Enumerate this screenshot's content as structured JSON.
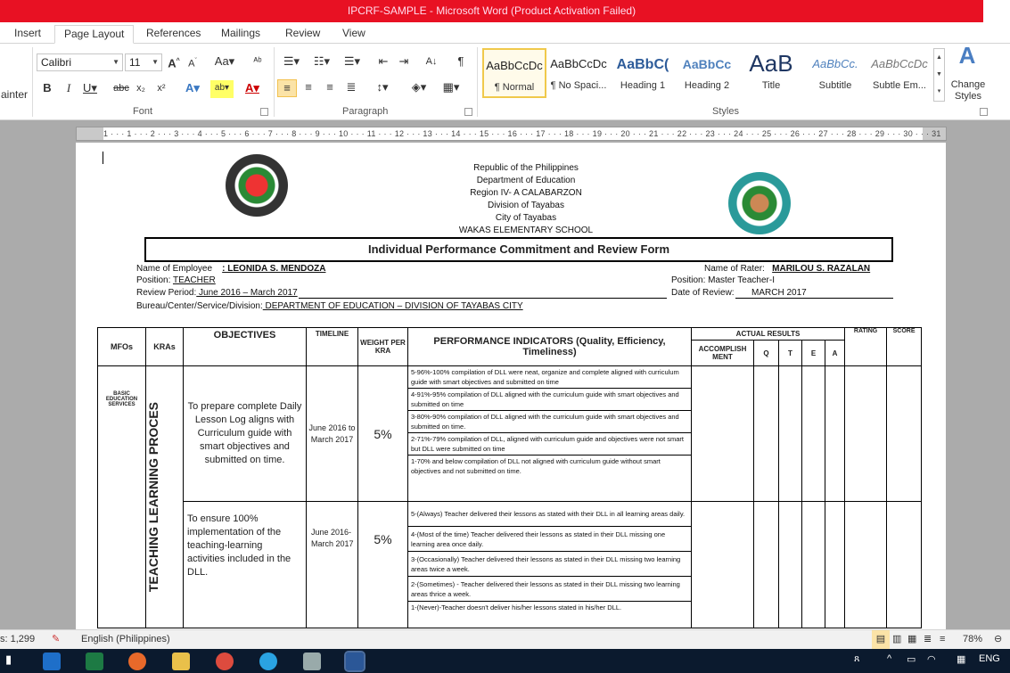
{
  "window": {
    "title": "IPCRF-SAMPLE  -  Microsoft Word (Product Activation Failed)"
  },
  "tabs": [
    "Insert",
    "Page Layout",
    "References",
    "Mailings",
    "Review",
    "View"
  ],
  "active_tab": "Page Layout",
  "ribbon": {
    "clipboard_cut_label": "ainter",
    "font": {
      "name": "Calibri",
      "size": "11",
      "group_label": "Font"
    },
    "paragraph": {
      "group_label": "Paragraph"
    },
    "styles": {
      "group_label": "Styles",
      "items": [
        {
          "sample": "AaBbCcDc",
          "name": "¶ Normal"
        },
        {
          "sample": "AaBbCcDc",
          "name": "¶ No Spaci..."
        },
        {
          "sample": "AaBbC(",
          "name": "Heading 1"
        },
        {
          "sample": "AaBbCc",
          "name": "Heading 2"
        },
        {
          "sample": "AaB",
          "name": "Title"
        },
        {
          "sample": "AaBbCc.",
          "name": "Subtitle"
        },
        {
          "sample": "AaBbCcDc",
          "name": "Subtle Em..."
        }
      ],
      "change_styles": "Change Styles"
    }
  },
  "ruler": {
    "text": "1 · · · 1 · · · 2 · · · 3 · · · 4 · · · 5 · · · 6 · · · 7 · · · 8 · · · 9 · · · 10 · · · 11 · · · 12 · · · 13 · · · 14 · · · 15 · · · 16 · · · 17 · · · 18 · · · 19 · · · 20 · · · 21 · · · 22 · · · 23 · · · 24 · · · 25 · · · 26 · · · 27 · · · 28 · · · 29 · · · 30 · · · 31"
  },
  "document": {
    "header_lines": [
      "Republic of the Philippines",
      "Department of Education",
      "Region IV- A CALABARZON",
      "Division of Tayabas",
      "City of Tayabas",
      "WAKAS ELEMENTARY   SCHOOL"
    ],
    "form_title": "Individual Performance Commitment and Review Form",
    "employee_label": "Name of Employee",
    "employee_name": ":  LEONIDA  S.  MENDOZA",
    "position_label": "Position:",
    "position_value": "TEACHER",
    "review_period_label": "Review Period:",
    "review_period_value": " June 2016 – March  2017",
    "bureau_label": "Bureau/Center/Service/Division:",
    "bureau_value": " DEPARTMENT   OF EDUCATION   – DIVISION OF TAYABAS   CITY",
    "rater_label": "Name of Rater:",
    "rater_name": "MARILOU S. RAZALAN",
    "rater_position": "Position: Master Teacher-I",
    "date_review_label": "Date of Review:",
    "date_review_value": "MARCH  2017",
    "table": {
      "headers": {
        "mfos": "MFOs",
        "kras": "KRAs",
        "objectives": "OBJECTIVES",
        "timeline": "TIMELINE",
        "weight": "WEIGHT PER KRA",
        "indicators": "PERFORMANCE INDICATORS (Quality, Efficiency, Timeliness)",
        "actual_results": "ACTUAL RESULTS",
        "accomplishment": "ACCOMPLISH MENT",
        "q": "Q",
        "t": "T",
        "e": "E",
        "a": "A",
        "rating": "RATING",
        "score": "SCORE"
      },
      "mfo": "BASIC EDUCATION SERVICES",
      "kra": "TEACHING LEARNING PROCES",
      "rows": [
        {
          "objective": "To prepare complete Daily Lesson Log aligns with Curriculum guide with smart objectives and submitted on time.",
          "timeline": "June 2016 to March 2017",
          "weight": "5%",
          "indicators": [
            "5-96%-100% compilation of DLL were neat, organize and complete aligned  with curriculum guide with smart objectives  and  submitted on time",
            "4-91%-95% compilation of DLL aligned  with the curriculum guide with smart objectives  and submitted on time",
            "3-80%-90% compilation of DLL aligned  with the curriculum guide with smart objectives  and submitted on time.",
            "2-71%-79% compilation of DLL, aligned  with curriculum guide  and objectives were  not smart but DLL were  submitted on time",
            "1-70% and below  compilation  of DLL not aligned  with curriculum guide without smart objectives  and not submitted  on time."
          ]
        },
        {
          "objective": "To ensure 100% implementation of the teaching-learning activities included in the DLL.",
          "timeline": "June 2016- March 2017",
          "weight": "5%",
          "indicators": [
            "5-(Always) Teacher  delivered  their lessons as stated with their DLL in all learning areas  daily.",
            "4-(Most of the time) Teacher  delivered  their lessons as stated  in their DLL missing one learning  area  once daily.",
            "3-(Occasionally) Teacher delivered  their lessons as stated  in their DLL missing two learning areas  twice a week.",
            "2-(Sometimes)  - Teacher  delivered  their lessons as stated  in their DLL missing two learning  areas  thrice a week.",
            "1-(Never)-Teacher   doesn't deliver  his/her lessons stated in his/her DLL."
          ]
        }
      ]
    }
  },
  "status": {
    "words": "s: 1,299",
    "language": "English (Philippines)",
    "zoom": "78%"
  },
  "taskbar": {
    "lang": "ENG"
  }
}
